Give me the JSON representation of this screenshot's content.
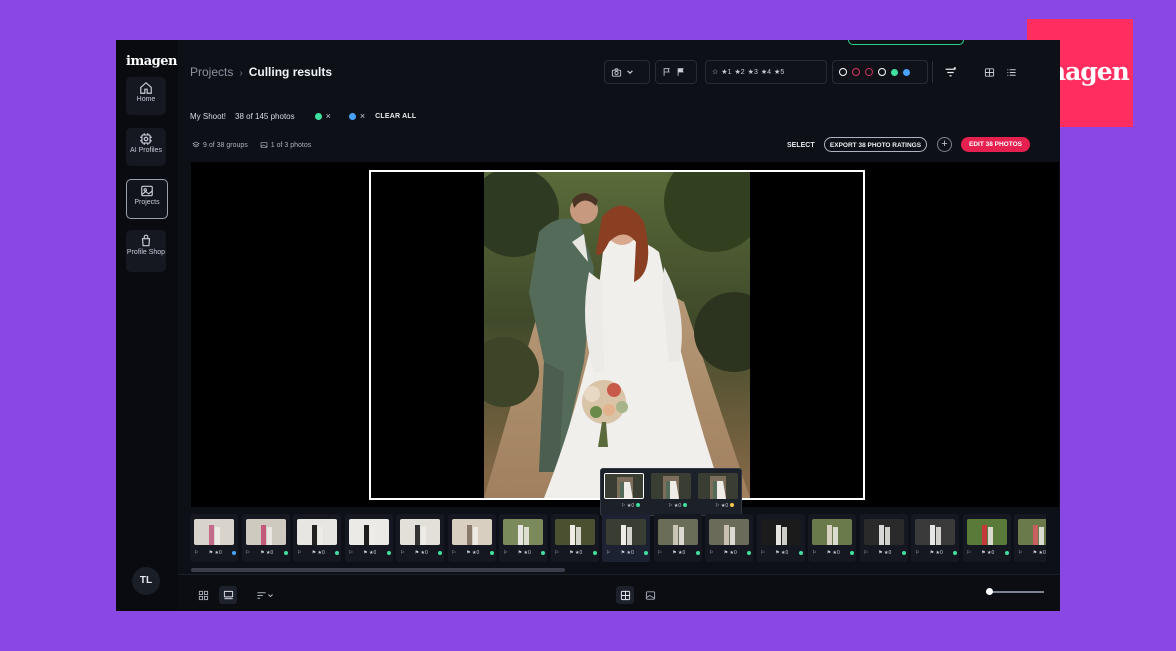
{
  "app": {
    "logo": "imagen"
  },
  "brand": {
    "logo": "imagen",
    "color": "#ff2d60"
  },
  "sidebar": {
    "items": [
      {
        "label": "Home",
        "icon": "home-icon"
      },
      {
        "label": "AI Profiles",
        "icon": "ai-profile-icon"
      },
      {
        "label": "Projects",
        "icon": "image-icon",
        "active": true
      },
      {
        "label": "Profile Shop",
        "icon": "shop-icon"
      }
    ],
    "avatar": "TL"
  },
  "header": {
    "breadcrumb": [
      "Projects",
      "Culling results"
    ],
    "ratings": [
      "1",
      "2",
      "3",
      "4",
      "5"
    ],
    "color_labels": [
      "#ffffff",
      "#e0345c",
      "#c8325c",
      "#ffffff",
      "#3fe0a0",
      "#47a3ff"
    ]
  },
  "filters": {
    "project": "My Shoot!",
    "count": "38 of 145 photos",
    "chip_colors": [
      "#3fe0a0",
      "#47a3ff"
    ],
    "clear_all": "CLEAR ALL"
  },
  "stats": {
    "groups": "9 of 38 groups",
    "photos": "1 of 3 photos"
  },
  "actions": {
    "select": "SELECT",
    "export": "EXPORT 38 PHOTO RATINGS",
    "edit": "EDIT 38 PHOTOS"
  },
  "popover": {
    "items": [
      {
        "meta": "0",
        "color": "#3fe0a0"
      },
      {
        "meta": "0",
        "color": "#3fe0a0"
      },
      {
        "meta": "0",
        "color": "#f5c84c"
      }
    ]
  },
  "filmstrip": {
    "items": [
      {
        "meta": "0",
        "color": "#47a3ff"
      },
      {
        "meta": "0",
        "color": "#3fe0a0"
      },
      {
        "meta": "0",
        "color": "#3fe0a0"
      },
      {
        "meta": "0",
        "color": "#3fe0a0"
      },
      {
        "meta": "0",
        "color": "#3fe0a0"
      },
      {
        "meta": "0",
        "color": "#3fe0a0"
      },
      {
        "meta": "0",
        "color": "#3fe0a0"
      },
      {
        "meta": "0",
        "color": "#3fe0a0"
      },
      {
        "meta": "0",
        "color": "#3fe0a0"
      },
      {
        "meta": "0",
        "color": "#3fe0a0"
      },
      {
        "meta": "0",
        "color": "#3fe0a0"
      },
      {
        "meta": "0",
        "color": "#3fe0a0"
      },
      {
        "meta": "0",
        "color": "#3fe0a0"
      },
      {
        "meta": "0",
        "color": "#3fe0a0"
      },
      {
        "meta": "0",
        "color": "#3fe0a0"
      },
      {
        "meta": "0",
        "color": "#3fe0a0"
      },
      {
        "meta": "0",
        "color": "#3fe0a0"
      }
    ]
  }
}
